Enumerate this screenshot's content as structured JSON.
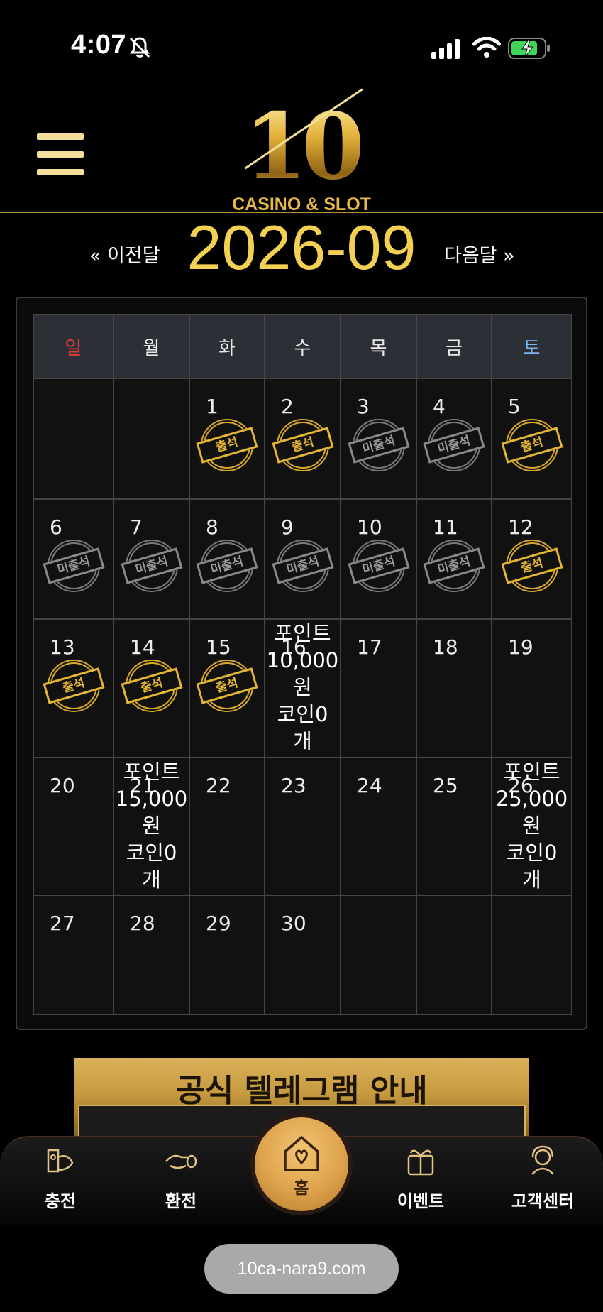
{
  "status_bar": {
    "time": "4:07"
  },
  "header": {
    "logo_number": "10",
    "logo_subtitle": "CASINO & SLOT"
  },
  "month_nav": {
    "prev_label": "« 이전달",
    "title": "2026-09",
    "next_label": "다음달 »"
  },
  "calendar": {
    "weekdays": [
      "일",
      "월",
      "화",
      "수",
      "목",
      "금",
      "토"
    ],
    "stamp_attend": "출석",
    "stamp_absent": "미출석",
    "weeks": [
      [
        {
          "day": "",
          "stamp": "",
          "reward": []
        },
        {
          "day": "",
          "stamp": "",
          "reward": []
        },
        {
          "day": "1",
          "stamp": "attend",
          "reward": []
        },
        {
          "day": "2",
          "stamp": "attend",
          "reward": []
        },
        {
          "day": "3",
          "stamp": "absent",
          "reward": []
        },
        {
          "day": "4",
          "stamp": "absent",
          "reward": []
        },
        {
          "day": "5",
          "stamp": "attend",
          "reward": []
        }
      ],
      [
        {
          "day": "6",
          "stamp": "absent",
          "reward": []
        },
        {
          "day": "7",
          "stamp": "absent",
          "reward": []
        },
        {
          "day": "8",
          "stamp": "absent",
          "reward": []
        },
        {
          "day": "9",
          "stamp": "absent",
          "reward": []
        },
        {
          "day": "10",
          "stamp": "absent",
          "reward": []
        },
        {
          "day": "11",
          "stamp": "absent",
          "reward": []
        },
        {
          "day": "12",
          "stamp": "attend",
          "reward": []
        }
      ],
      [
        {
          "day": "13",
          "stamp": "attend",
          "reward": []
        },
        {
          "day": "14",
          "stamp": "attend",
          "reward": []
        },
        {
          "day": "15",
          "stamp": "attend",
          "reward": []
        },
        {
          "day": "16",
          "stamp": "",
          "reward": [
            "포인트",
            "10,000",
            "원",
            "코인0",
            "개"
          ]
        },
        {
          "day": "17",
          "stamp": "",
          "reward": []
        },
        {
          "day": "18",
          "stamp": "",
          "reward": []
        },
        {
          "day": "19",
          "stamp": "",
          "reward": []
        }
      ],
      [
        {
          "day": "20",
          "stamp": "",
          "reward": []
        },
        {
          "day": "21",
          "stamp": "",
          "reward": [
            "포인트",
            "15,000",
            "원",
            "코인0",
            "개"
          ]
        },
        {
          "day": "22",
          "stamp": "",
          "reward": []
        },
        {
          "day": "23",
          "stamp": "",
          "reward": []
        },
        {
          "day": "24",
          "stamp": "",
          "reward": []
        },
        {
          "day": "25",
          "stamp": "",
          "reward": []
        },
        {
          "day": "26",
          "stamp": "",
          "reward": [
            "포인트",
            "25,000",
            "원",
            "코인0",
            "개"
          ]
        }
      ],
      [
        {
          "day": "27",
          "stamp": "",
          "reward": []
        },
        {
          "day": "28",
          "stamp": "",
          "reward": []
        },
        {
          "day": "29",
          "stamp": "",
          "reward": []
        },
        {
          "day": "30",
          "stamp": "",
          "reward": []
        },
        {
          "day": "",
          "stamp": "",
          "reward": []
        },
        {
          "day": "",
          "stamp": "",
          "reward": []
        },
        {
          "day": "",
          "stamp": "",
          "reward": []
        }
      ]
    ]
  },
  "banner": {
    "title": "공식 텔레그램 안내"
  },
  "bottom_nav": {
    "items": [
      {
        "label": "충전",
        "icon": "deposit-icon"
      },
      {
        "label": "환전",
        "icon": "withdraw-icon"
      },
      {
        "label": "홈",
        "icon": "home-icon"
      },
      {
        "label": "이벤트",
        "icon": "gift-icon"
      },
      {
        "label": "고객센터",
        "icon": "support-icon"
      }
    ]
  },
  "browser": {
    "url": "10ca-nara9.com"
  },
  "colors": {
    "gold": "#f3cf52",
    "sunday": "#e33d36",
    "saturday": "#7fb6f0",
    "background": "#000000"
  }
}
